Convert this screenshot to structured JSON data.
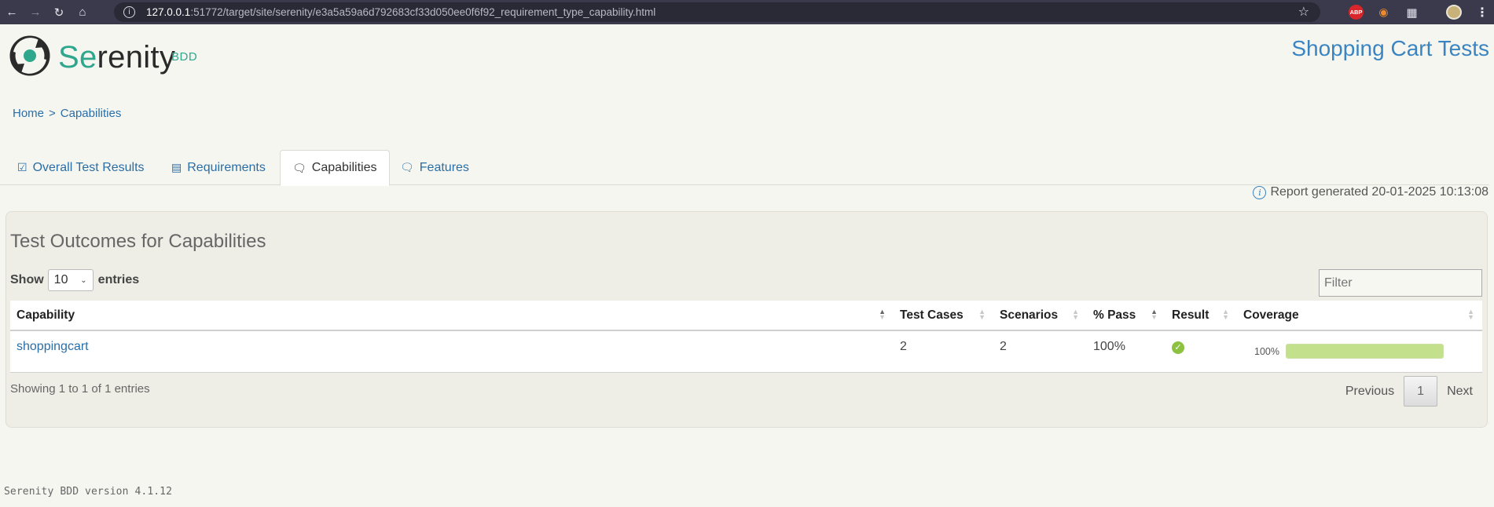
{
  "browser": {
    "url_host": "127.0.0.1",
    "url_rest": ":51772/target/site/serenity/e3a5a59a6d792683cf33d050ee0f6f92_requirement_type_capability.html",
    "ext_abp_label": "ABP"
  },
  "header": {
    "brand_se": "Se",
    "brand_rest": "renity",
    "brand_bdd": "BDD",
    "project_title": "Shopping Cart Tests"
  },
  "breadcrumb": {
    "home": "Home",
    "separator": ">",
    "current": "Capabilities"
  },
  "tabs": [
    {
      "label": "Overall Test Results"
    },
    {
      "label": "Requirements"
    },
    {
      "label": "Capabilities"
    },
    {
      "label": "Features"
    }
  ],
  "report_generated": "Report generated 20-01-2025 10:13:08",
  "panel": {
    "title": "Test Outcomes for Capabilities",
    "show_label": "Show",
    "entries_value": "10",
    "entries_label": "entries",
    "filter_placeholder": "Filter",
    "columns": [
      "Capability",
      "Test Cases",
      "Scenarios",
      "% Pass",
      "Result",
      "Coverage"
    ],
    "rows": [
      {
        "capability": "shoppingcart",
        "test_cases": "2",
        "scenarios": "2",
        "pass": "100%",
        "result": "success",
        "coverage_label": "100%",
        "coverage": 1.0
      }
    ],
    "showing": "Showing 1 to 1 of 1 entries",
    "pager": {
      "previous": "Previous",
      "page": "1",
      "next": "Next"
    }
  },
  "footer": "Serenity BDD version 4.1.12",
  "colors": {
    "brand_green": "#2ea78c",
    "link_blue": "#2a6ea6",
    "title_blue": "#3a85c1",
    "success_green": "#8cc23f",
    "coverage_fill": "#c3e08c"
  }
}
